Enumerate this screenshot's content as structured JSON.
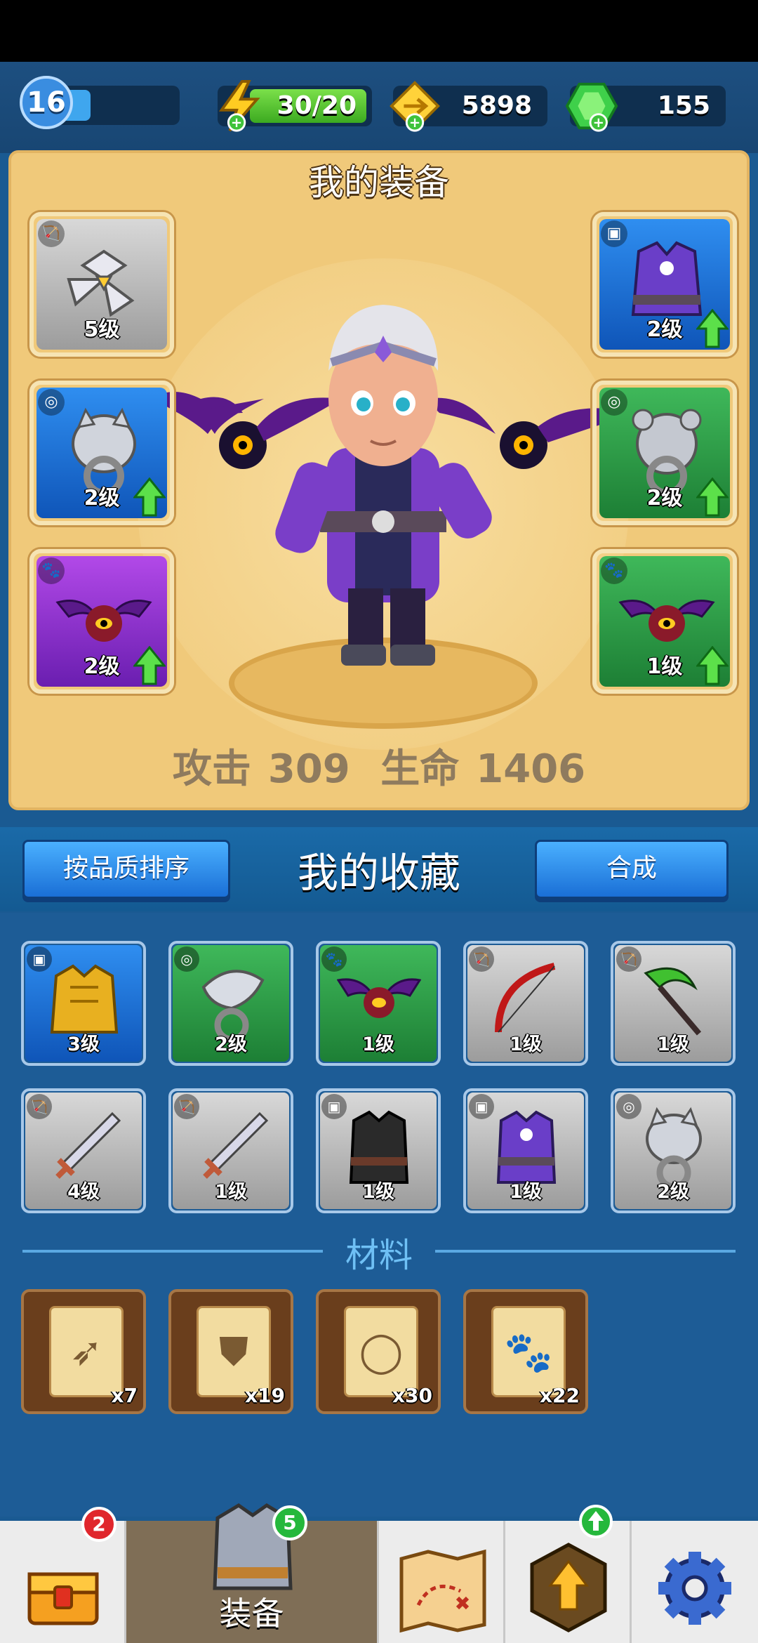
{
  "top_bar": {
    "player_level": "16",
    "xp_progress": 0.35,
    "energy": "30/20",
    "gold": "5898",
    "gems": "155"
  },
  "equipment": {
    "title": "我的装备",
    "slots": [
      {
        "category": "bow",
        "level": "5级",
        "rarity": "grey",
        "item": "shuriken-weapon",
        "upgrade": false
      },
      {
        "category": "ring",
        "level": "2级",
        "rarity": "blue",
        "item": "wolf-ring",
        "upgrade": true
      },
      {
        "category": "pet",
        "level": "2级",
        "rarity": "purple",
        "item": "bat-pet",
        "upgrade": true
      },
      {
        "category": "armor",
        "level": "2级",
        "rarity": "blue",
        "item": "purple-robe",
        "upgrade": true
      },
      {
        "category": "ring",
        "level": "2级",
        "rarity": "green",
        "item": "bear-ring",
        "upgrade": true
      },
      {
        "category": "pet",
        "level": "1级",
        "rarity": "green",
        "item": "bat-pet",
        "upgrade": true
      }
    ],
    "stats": {
      "attack_label": "攻击",
      "attack_value": "309",
      "hp_label": "生命",
      "hp_value": "1406"
    }
  },
  "collection": {
    "sort_button": "按品质排序",
    "title": "我的收藏",
    "combine_button": "合成",
    "items": [
      {
        "category": "armor",
        "level": "3级",
        "rarity": "blue",
        "item": "gold-armor"
      },
      {
        "category": "ring",
        "level": "2级",
        "rarity": "green",
        "item": "eagle-ring"
      },
      {
        "category": "pet",
        "level": "1级",
        "rarity": "green",
        "item": "bat-pet"
      },
      {
        "category": "bow",
        "level": "1级",
        "rarity": "grey",
        "item": "red-bow"
      },
      {
        "category": "bow",
        "level": "1级",
        "rarity": "grey",
        "item": "scythe"
      },
      {
        "category": "bow",
        "level": "4级",
        "rarity": "grey",
        "item": "saw-sword"
      },
      {
        "category": "bow",
        "level": "1级",
        "rarity": "grey",
        "item": "saw-sword"
      },
      {
        "category": "armor",
        "level": "1级",
        "rarity": "grey",
        "item": "dark-vest"
      },
      {
        "category": "armor",
        "level": "1级",
        "rarity": "grey",
        "item": "purple-robe"
      },
      {
        "category": "ring",
        "level": "2级",
        "rarity": "grey",
        "item": "wolf-ring"
      }
    ]
  },
  "materials": {
    "title": "材料",
    "items": [
      {
        "type": "bow-scroll",
        "count": "x7"
      },
      {
        "type": "armor-scroll",
        "count": "x19"
      },
      {
        "type": "ring-scroll",
        "count": "x30"
      },
      {
        "type": "pet-scroll",
        "count": "x22"
      }
    ]
  },
  "nav": {
    "chest_badge": "2",
    "equip_badge": "5",
    "equip_label": "装备",
    "active": "equipment"
  },
  "colors": {
    "grey": "#b5b5b5",
    "blue": "#1f72d8",
    "green": "#2a9a46",
    "purple": "#8e32cc",
    "panel": "#f0c97a"
  }
}
